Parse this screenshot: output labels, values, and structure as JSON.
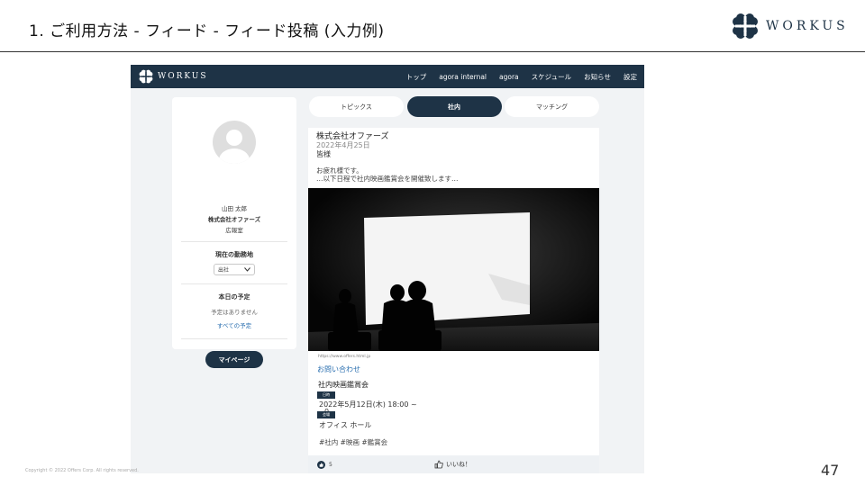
{
  "slide": {
    "title": "1. ご利用方法 - フィード - フィード投稿 (入力例)",
    "brand": "WORKUS",
    "page_number": "47",
    "copyright": "Copyright © 2022 Offers Corp. All rights reserved."
  },
  "app": {
    "logo": "WORKUS",
    "nav": [
      "トップ",
      "agora internal",
      "agora",
      "スケジュール",
      "お知らせ",
      "設定"
    ],
    "colors": {
      "navy": "#1e3346",
      "link": "#2a6fb0"
    }
  },
  "profile": {
    "name": "山田 太郎",
    "company": "株式会社オファーズ",
    "department": "広報室",
    "location_title": "現在の勤務地",
    "location_value": "出社",
    "schedule_title": "本日の予定",
    "schedule_empty": "予定はありません",
    "all_schedules": "すべての予定",
    "mypage_button": "マイページ"
  },
  "tabs": [
    {
      "label": "トピックス",
      "active": false
    },
    {
      "label": "社内",
      "active": true
    },
    {
      "label": "マッチング",
      "active": false
    }
  ],
  "post": {
    "company": "株式会社オファーズ",
    "date": "2022年4月25日",
    "greeting": "皆様",
    "line1": "お疲れ様です。",
    "line2": "…以下日程で社内映画鑑賞会を開催致します…",
    "url": "https://www.offers.html.jp",
    "contact": "お問い合わせ",
    "event_title": "社内映画鑑賞会",
    "date_badge": "日時",
    "event_date": "2022年5月12日(木) 18:00 ~",
    "event_date_cont": "0",
    "place_badge": "会場",
    "event_place": "オフィス ホール",
    "tags": "#社内 #映画 #鑑賞会",
    "reaction_count": "5",
    "like_label": "いいね！"
  }
}
